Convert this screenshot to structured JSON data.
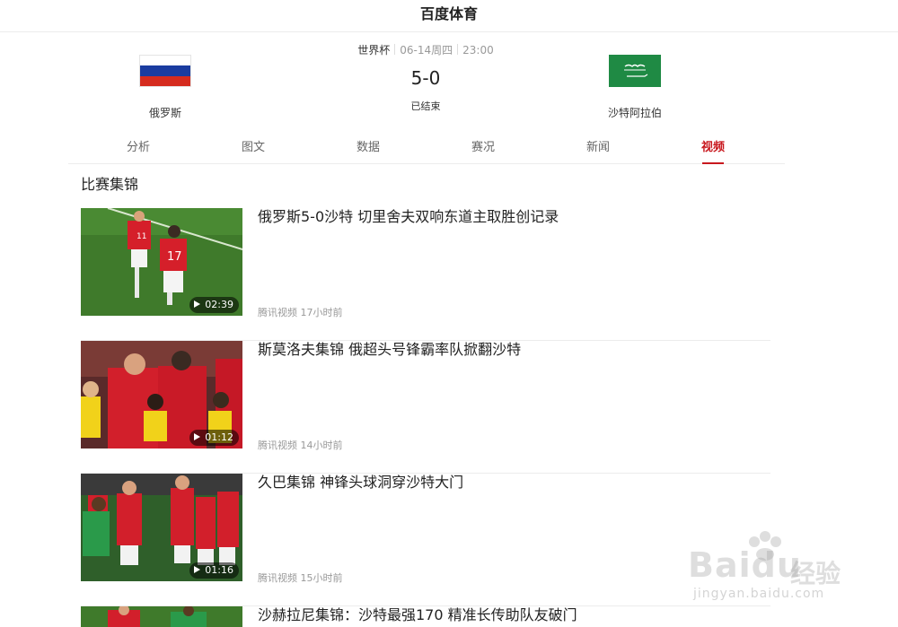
{
  "header": {
    "title": "百度体育"
  },
  "match": {
    "league": "世界杯",
    "date": "06-14周四",
    "time": "23:00",
    "score": "5-0",
    "status": "已结束",
    "home": {
      "name": "俄罗斯",
      "flag_colors": [
        "#ffffff",
        "#1a3ca0",
        "#d52b1e"
      ]
    },
    "away": {
      "name": "沙特阿拉伯",
      "flag_color": "#1f8a44"
    }
  },
  "tabs": [
    {
      "label": "分析",
      "active": false
    },
    {
      "label": "图文",
      "active": false
    },
    {
      "label": "数据",
      "active": false
    },
    {
      "label": "赛况",
      "active": false
    },
    {
      "label": "新闻",
      "active": false
    },
    {
      "label": "视频",
      "active": true
    }
  ],
  "accent_color": "#c8181e",
  "section": {
    "title": "比赛集锦"
  },
  "videos": [
    {
      "title": "俄罗斯5-0沙特 切里舍夫双响东道主取胜创记录",
      "duration": "02:39",
      "source": "腾讯视频 17小时前"
    },
    {
      "title": "斯莫洛夫集锦 俄超头号锋霸率队掀翻沙特",
      "duration": "01:12",
      "source": "腾讯视频 14小时前"
    },
    {
      "title": "久巴集锦 神锋头球洞穿沙特大门",
      "duration": "01:16",
      "source": "腾讯视频 15小时前"
    },
    {
      "title": "沙赫拉尼集锦：沙特最强170 精准长传助队友破门",
      "duration": "",
      "source": ""
    }
  ],
  "watermark": {
    "brand": "Bai",
    "brand2": "du",
    "cn": "经验",
    "url": "jingyan.baidu.com"
  }
}
